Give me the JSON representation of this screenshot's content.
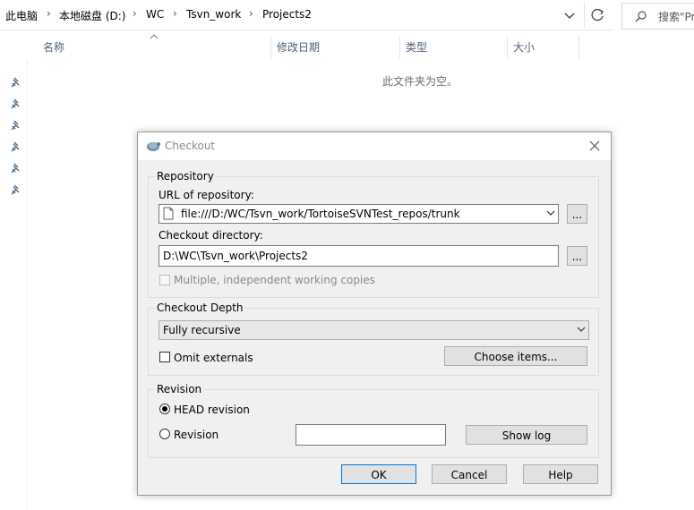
{
  "explorer": {
    "breadcrumbs": [
      "此电脑",
      "本地磁盘 (D:)",
      "WC",
      "Tsvn_work",
      "Projects2"
    ],
    "search_placeholder": "搜索\"Pr",
    "columns": {
      "name": "名称",
      "date_modified": "修改日期",
      "type": "类型",
      "size": "大小"
    },
    "empty_message": "此文件夹为空。"
  },
  "dialog": {
    "title": "Checkout",
    "repository": {
      "group_label": "Repository",
      "url_label": "URL of repository:",
      "url_value": "file:///D:/WC/Tsvn_work/TortoiseSVNTest_repos/trunk",
      "browse_label": "...",
      "dir_label": "Checkout directory:",
      "dir_value": "D:\\WC\\Tsvn_work\\Projects2",
      "dir_browse_label": "...",
      "multiple_label": "Multiple, independent working copies",
      "multiple_checked": false,
      "multiple_enabled": false
    },
    "depth": {
      "group_label": "Checkout Depth",
      "selected": "Fully recursive",
      "omit_externals_label": "Omit externals",
      "omit_externals_checked": false,
      "choose_items_label": "Choose items..."
    },
    "revision": {
      "group_label": "Revision",
      "head_label": "HEAD revision",
      "head_selected": true,
      "revision_label": "Revision",
      "revision_value": "",
      "show_log_label": "Show log"
    },
    "buttons": {
      "ok": "OK",
      "cancel": "Cancel",
      "help": "Help"
    }
  }
}
